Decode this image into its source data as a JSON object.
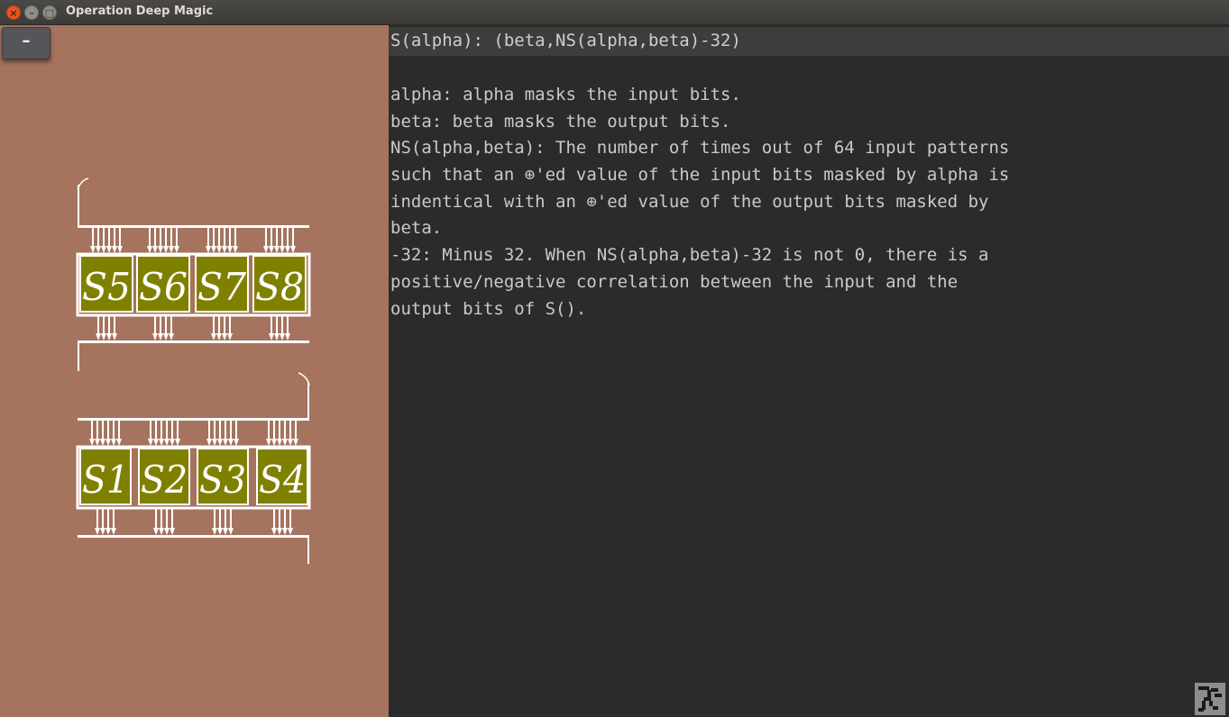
{
  "window": {
    "title": "Operation Deep Magic",
    "close_glyph": "×",
    "minimize_glyph": "–",
    "maximize_glyph": "□"
  },
  "left_pane": {
    "collapse_button_label": "–",
    "sbox_groups": [
      {
        "labels": [
          "S5",
          "S6",
          "S7",
          "S8"
        ]
      },
      {
        "labels": [
          "S1",
          "S2",
          "S3",
          "S4"
        ]
      }
    ],
    "colors": {
      "background": "#a5735e",
      "sbox_fill": "#808000",
      "wire": "#ffffff"
    }
  },
  "right_pane": {
    "formula": "S(alpha): (beta,NS(alpha,beta)-32)",
    "description_lines": [
      "alpha: alpha masks the input bits.",
      "beta: beta masks the output bits.",
      "NS(alpha,beta): The number of times out of 64 input patterns",
      "such that an ⊕'ed value of the input bits masked by alpha is",
      "indentical with an ⊕'ed value of the output bits masked by",
      "beta.",
      "-32: Minus 32. When NS(alpha,beta)-32 is not 0, there is a",
      "positive/negative correlation between the input and the",
      "output bits of S()."
    ],
    "corner_icon": "runner-icon"
  }
}
